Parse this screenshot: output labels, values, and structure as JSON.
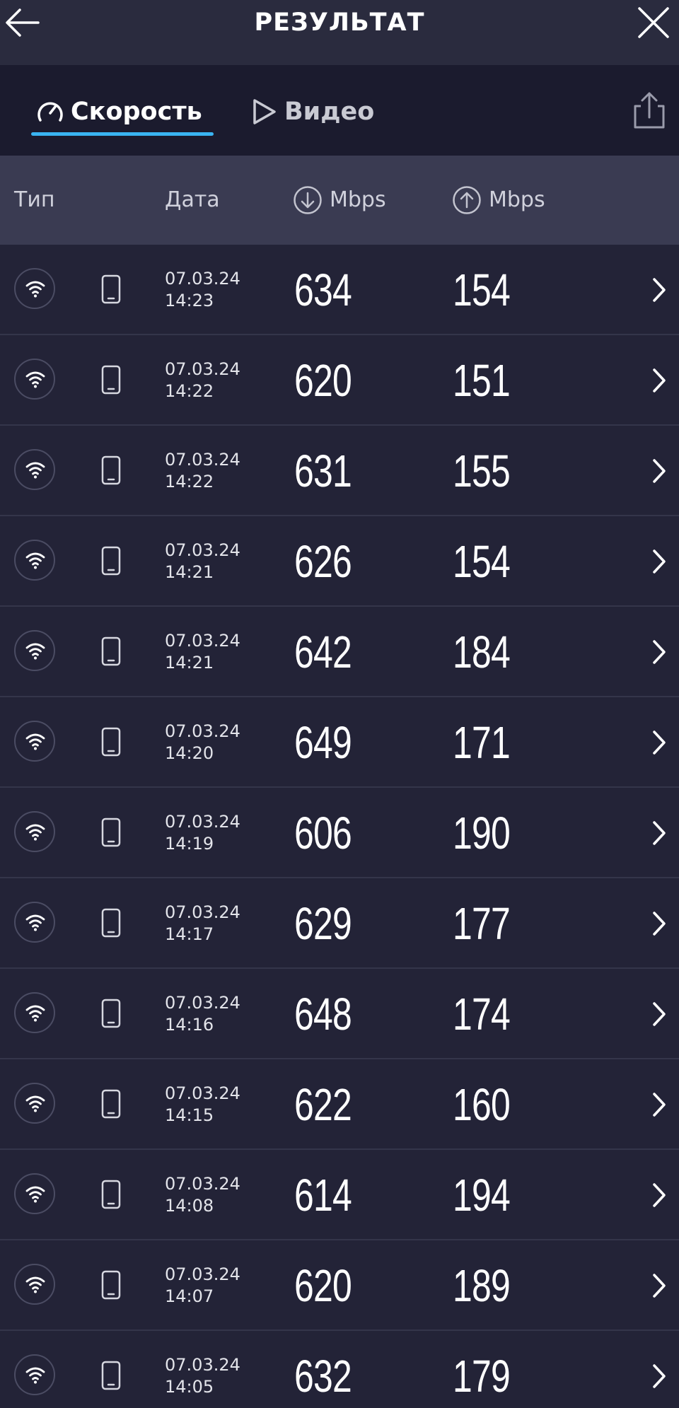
{
  "header": {
    "title": "РЕЗУЛЬТАТ",
    "back_icon": "arrow-left-icon",
    "close_icon": "close-icon"
  },
  "tabs": [
    {
      "label": "Скорость",
      "icon": "speedometer-icon",
      "active": true
    },
    {
      "label": "Видео",
      "icon": "play-icon",
      "active": false
    }
  ],
  "share_icon": "share-icon",
  "table": {
    "columns": {
      "type": "Тип",
      "date": "Дата",
      "download": "Mbps",
      "upload": "Mbps"
    },
    "rows": [
      {
        "date": "07.03.24",
        "time": "14:23",
        "down": "634",
        "up": "154"
      },
      {
        "date": "07.03.24",
        "time": "14:22",
        "down": "620",
        "up": "151"
      },
      {
        "date": "07.03.24",
        "time": "14:22",
        "down": "631",
        "up": "155"
      },
      {
        "date": "07.03.24",
        "time": "14:21",
        "down": "626",
        "up": "154"
      },
      {
        "date": "07.03.24",
        "time": "14:21",
        "down": "642",
        "up": "184"
      },
      {
        "date": "07.03.24",
        "time": "14:20",
        "down": "649",
        "up": "171"
      },
      {
        "date": "07.03.24",
        "time": "14:19",
        "down": "606",
        "up": "190"
      },
      {
        "date": "07.03.24",
        "time": "14:17",
        "down": "629",
        "up": "177"
      },
      {
        "date": "07.03.24",
        "time": "14:16",
        "down": "648",
        "up": "174"
      },
      {
        "date": "07.03.24",
        "time": "14:15",
        "down": "622",
        "up": "160"
      },
      {
        "date": "07.03.24",
        "time": "14:08",
        "down": "614",
        "up": "194"
      },
      {
        "date": "07.03.24",
        "time": "14:07",
        "down": "620",
        "up": "189"
      },
      {
        "date": "07.03.24",
        "time": "14:05",
        "down": "632",
        "up": "179"
      }
    ]
  },
  "colors": {
    "background": "#232337",
    "header": "#2a2b3e",
    "tabbar": "#1b1b2e",
    "table_header": "#3a3b52",
    "accent": "#3ab4f2"
  }
}
